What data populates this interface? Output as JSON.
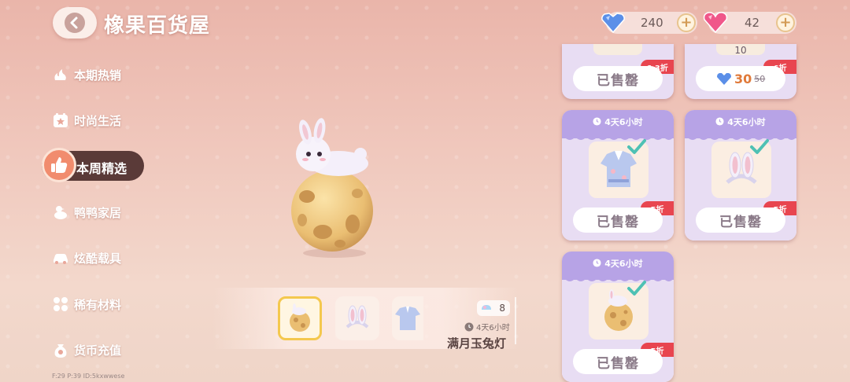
{
  "header": {
    "title": "橡果百货屋",
    "currencies": [
      {
        "icon": "blue-diamond-icon",
        "value": "240"
      },
      {
        "icon": "pink-heart-gem-icon",
        "value": "42"
      }
    ],
    "plus_label": "+"
  },
  "sidebar": {
    "items": [
      {
        "label": "本期热销",
        "icon": "fire-icon"
      },
      {
        "label": "时尚生活",
        "icon": "calendar-icon"
      },
      {
        "label": "本周精选",
        "icon": "thumbs-up-icon",
        "active": true
      },
      {
        "label": "鸭鸭家居",
        "icon": "duck-icon"
      },
      {
        "label": "炫酷载具",
        "icon": "car-icon"
      },
      {
        "label": "稀有材料",
        "icon": "materials-icon"
      },
      {
        "label": "货币充值",
        "icon": "coin-bag-icon"
      }
    ]
  },
  "preview": {
    "item_name": "满月玉兔灯",
    "timer": "4天6小时",
    "count": "8"
  },
  "debug_text": "F:29 P:39 ID:5kxwwese",
  "shop": {
    "sold_label": "已售罄",
    "top_cards": [
      {
        "discount": "6.3折"
      },
      {
        "discount": "6折",
        "top_text": "10",
        "price_now": "30",
        "price_old": "50"
      }
    ],
    "cards": [
      {
        "timer": "4天6小时",
        "discount": "5折",
        "item": "outfit"
      },
      {
        "timer": "4天6小时",
        "discount": "5折",
        "item": "bunny-ears"
      },
      {
        "timer": "4天6小时",
        "discount": "5折",
        "item": "moon-rabbit-lamp"
      }
    ]
  },
  "colors": {
    "accent_purple": "#b7a3e6",
    "discount_red": "#e8454f",
    "active_tab": "#5a3a38"
  }
}
